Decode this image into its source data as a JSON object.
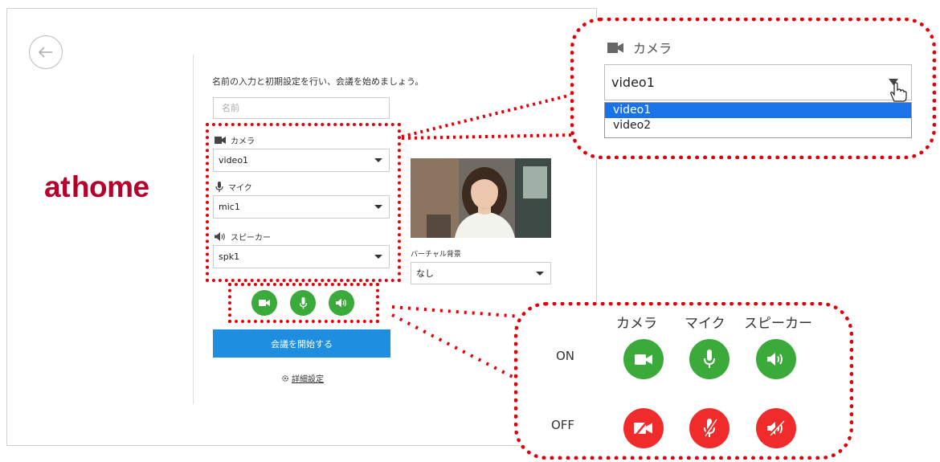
{
  "logo": "at home",
  "instruction": "名前の入力と初期設定を行い、会議を始めましょう。",
  "name_placeholder": "名前",
  "camera": {
    "label": "カメラ",
    "value": "video1"
  },
  "mic": {
    "label": "マイク",
    "value": "mic1"
  },
  "speaker": {
    "label": "スピーカー",
    "value": "spk1"
  },
  "virtual_bg": {
    "label": "バーチャル背景",
    "value": "なし"
  },
  "start_button": "会議を開始する",
  "advanced_link": "詳細設定",
  "callout_dropdown": {
    "label": "カメラ",
    "value": "video1",
    "options": [
      "video1",
      "video2"
    ],
    "selected_index": 0
  },
  "legend": {
    "headers": [
      "カメラ",
      "マイク",
      "スピーカー"
    ],
    "on_label": "ON",
    "off_label": "OFF"
  },
  "colors": {
    "on": "#3aab3a",
    "off": "#ef2b2b",
    "primary": "#1e8ee0",
    "brand": "#b5002c",
    "highlight": "#e0000a"
  }
}
